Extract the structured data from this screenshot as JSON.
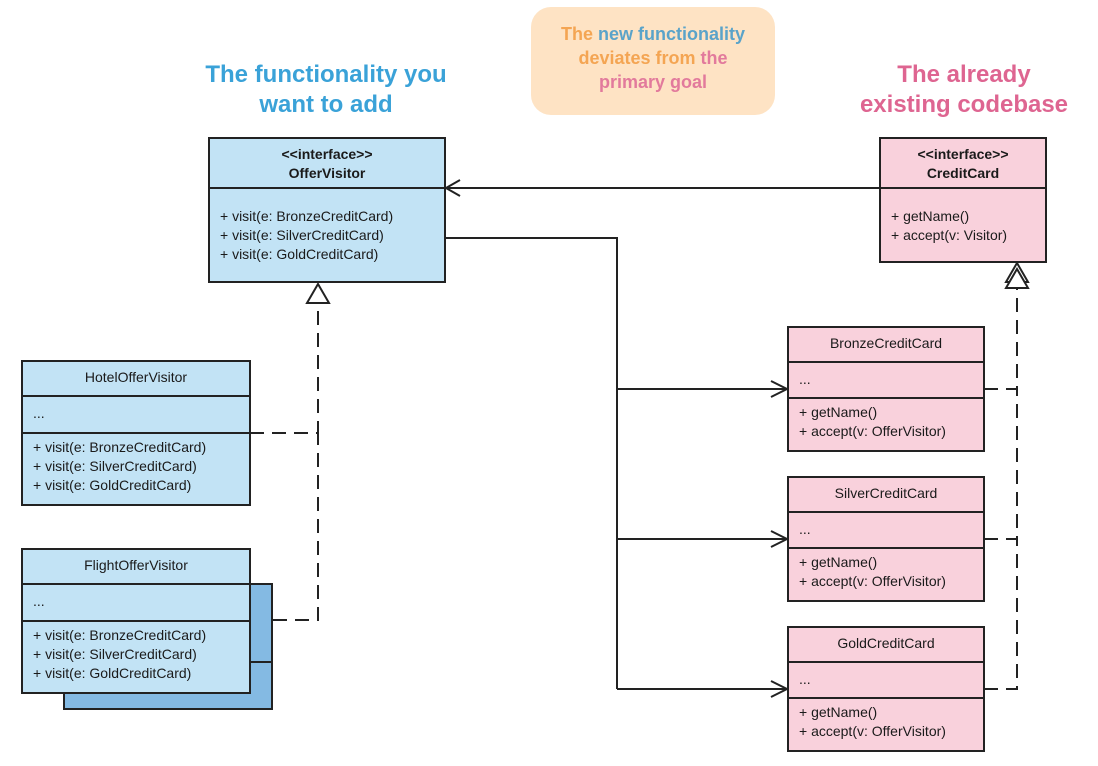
{
  "titles": {
    "left": [
      "The functionality you",
      "want to add"
    ],
    "right": [
      "The already",
      "existing codebase"
    ]
  },
  "note": {
    "line1": [
      {
        "text": "The ",
        "color": "orange"
      },
      {
        "text": "new functionality",
        "color": "blue"
      }
    ],
    "line2": [
      {
        "text": "deviates from ",
        "color": "orange"
      },
      {
        "text": "the",
        "color": "pink"
      }
    ],
    "line3": [
      {
        "text": "primary goal",
        "color": "pink"
      }
    ]
  },
  "colors": {
    "title_blue": "#3aa2d8",
    "title_pink": "#de6591",
    "note_bg": "#fee3c4",
    "visitor_fill": "#c2e3f5",
    "visitor_stack_fill": "#84bae3",
    "card_fill": "#f9d1dc",
    "line": "#222222"
  },
  "classes": {
    "offer_visitor": {
      "stereotype": "<<interface>>",
      "name": "OfferVisitor",
      "methods": [
        "+ visit(e: BronzeCreditCard)",
        "+ visit(e: SilverCreditCard)",
        "+ visit(e: GoldCreditCard)"
      ]
    },
    "credit_card": {
      "stereotype": "<<interface>>",
      "name": "CreditCard",
      "methods": [
        "+ getName()",
        "+ accept(v: Visitor)"
      ]
    },
    "hotel_offer_visitor": {
      "name": "HotelOfferVisitor",
      "attributes": "...",
      "methods": [
        "+ visit(e: BronzeCreditCard)",
        "+ visit(e: SilverCreditCard)",
        "+ visit(e: GoldCreditCard)"
      ]
    },
    "flight_offer_visitor": {
      "name": "FlightOfferVisitor",
      "attributes": "...",
      "methods": [
        "+ visit(e: BronzeCreditCard)",
        "+ visit(e: SilverCreditCard)",
        "+ visit(e: GoldCreditCard)"
      ]
    },
    "bronze_credit_card": {
      "name": "BronzeCreditCard",
      "attributes": "...",
      "methods": [
        "+ getName()",
        "+ accept(v: OfferVisitor)"
      ]
    },
    "silver_credit_card": {
      "name": "SilverCreditCard",
      "attributes": "...",
      "methods": [
        "+ getName()",
        "+ accept(v: OfferVisitor)"
      ]
    },
    "gold_credit_card": {
      "name": "GoldCreditCard",
      "attributes": "...",
      "methods": [
        "+ getName()",
        "+ accept(v: OfferVisitor)"
      ]
    }
  },
  "relations": [
    {
      "from": "CreditCard",
      "to": "OfferVisitor",
      "type": "association"
    },
    {
      "from": "OfferVisitor",
      "to": "BronzeCreditCard",
      "type": "association"
    },
    {
      "from": "OfferVisitor",
      "to": "SilverCreditCard",
      "type": "association"
    },
    {
      "from": "OfferVisitor",
      "to": "GoldCreditCard",
      "type": "association"
    },
    {
      "from": "HotelOfferVisitor",
      "to": "OfferVisitor",
      "type": "realization"
    },
    {
      "from": "FlightOfferVisitor",
      "to": "OfferVisitor",
      "type": "realization"
    },
    {
      "from": "BronzeCreditCard",
      "to": "CreditCard",
      "type": "realization"
    },
    {
      "from": "SilverCreditCard",
      "to": "CreditCard",
      "type": "realization"
    },
    {
      "from": "GoldCreditCard",
      "to": "CreditCard",
      "type": "realization"
    }
  ]
}
